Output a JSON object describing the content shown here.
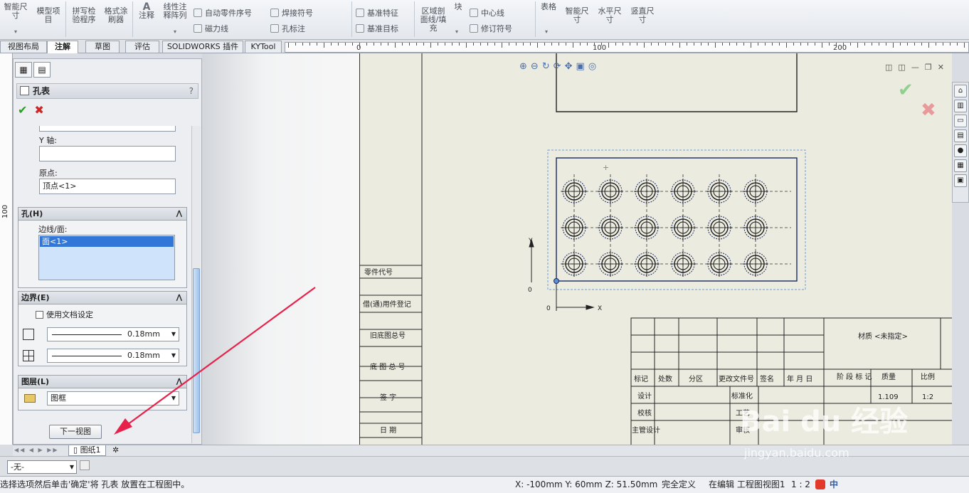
{
  "ribbon": {
    "smart_dim": "智能尺\n寸",
    "model_items": "模型项\n目",
    "spell_check": "拼写检\n验程序",
    "format_painter": "格式涂\n刷器",
    "note": "注释",
    "linear_pattern": "线性注\n释阵列",
    "auto_balloon": "自动零件序号",
    "magnetic_line": "磁力线",
    "weld_symbol": "焊接符号",
    "hole_callout": "孔标注",
    "datum_feature": "基准特征",
    "datum_target": "基准目标",
    "area_hatch": "区域剖\n面线/填\n充",
    "block": "块",
    "center_line": "中心线",
    "revision_symbol": "修订符号",
    "table": "表格",
    "smart_dim2": "智能尺\n寸",
    "horizontal_dim": "水平尺\n寸",
    "vertical_dim": "竖直尺\n寸"
  },
  "tabs": [
    "视图布局",
    "注解",
    "草图",
    "评估",
    "SOLIDWORKS 插件",
    "KYTool"
  ],
  "ruler": {
    "labels": [
      "0",
      "100",
      "200"
    ],
    "vlabel": "100"
  },
  "property_manager": {
    "title": "孔表",
    "help": "?",
    "ok": "✔",
    "cancel": "✖",
    "y_axis_label": "Y 轴:",
    "y_axis_value": "",
    "origin_label": "原点:",
    "origin_value": "顶点<1>",
    "holes_group": "孔(H)",
    "edges_faces_label": "边线/面:",
    "edges_faces_selected": "面<1>",
    "border_group": "边界(E)",
    "use_doc_settings": "使用文档设定",
    "border_width_1": "0.18mm",
    "border_width_2": "0.18mm",
    "layer_group": "图层(L)",
    "layer_value": "图框",
    "next_view": "下一视图"
  },
  "sheet_tab": "图纸1",
  "layer_select": "-无-",
  "drawing": {
    "axis_y": "Y",
    "axis_x": "X",
    "origin_zero": "0",
    "left_column": [
      "零件代号",
      "借(通)用件登记",
      "旧底图总号",
      "底 图 总 号",
      "签 字",
      "日 期"
    ],
    "title_material": "材质 <未指定>",
    "title_header": [
      "标记",
      "处数",
      "分区",
      "更改文件号",
      "签名",
      "年 月 日"
    ],
    "title_stage": "阶 段 标 记",
    "title_weight": "质量",
    "title_scale": "比例",
    "weight_value": "1.109",
    "scale_value": "1:2",
    "rows": [
      "设计",
      "校核",
      "主管设计"
    ],
    "std_label": "标准化",
    "process_label": "工艺",
    "review_label": "审核"
  },
  "status": {
    "hint": "选择选项然后单击'确定'将 孔表 放置在工程图中。",
    "coords": "X: -100mm Y: 60mm Z: 51.50mm",
    "defined": "完全定义",
    "editing": "在编辑 工程图视图1",
    "scale": "1 : 2",
    "ime": "中"
  },
  "watermark": {
    "brand": "Bai du 经验",
    "url": "jingyan.baidu.com"
  },
  "colors": {
    "accent_blue": "#3277d8",
    "arrow_red": "#e8214b",
    "sheet_bg": "#ecebe0"
  }
}
